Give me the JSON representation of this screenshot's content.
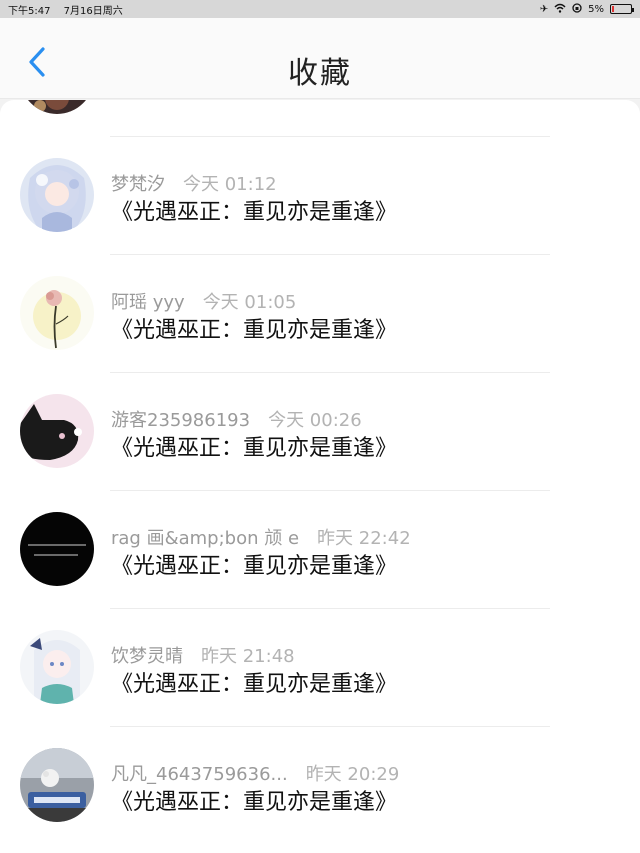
{
  "status_bar": {
    "time": "下午5:47",
    "date": "7月16日周六",
    "battery": "5%"
  },
  "header": {
    "title": "收藏"
  },
  "items": [
    {
      "user": "梦梵汐",
      "time": "今天 01:12",
      "post": "《光遇巫正：重见亦是重逢》"
    },
    {
      "user": "阿瑶 yyy",
      "time": "今天 01:05",
      "post": "《光遇巫正：重见亦是重逢》"
    },
    {
      "user": "游客235986193",
      "time": "今天 00:26",
      "post": "《光遇巫正：重见亦是重逢》"
    },
    {
      "user": "rag 画&amp;bon 颃 e",
      "time": "昨天 22:42",
      "post": "《光遇巫正：重见亦是重逢》"
    },
    {
      "user": "饮梦灵晴",
      "time": "昨天 21:48",
      "post": "《光遇巫正：重见亦是重逢》"
    },
    {
      "user": "凡凡_4643759636...",
      "time": "昨天 20:29",
      "post": "《光遇巫正：重见亦是重逢》"
    }
  ]
}
